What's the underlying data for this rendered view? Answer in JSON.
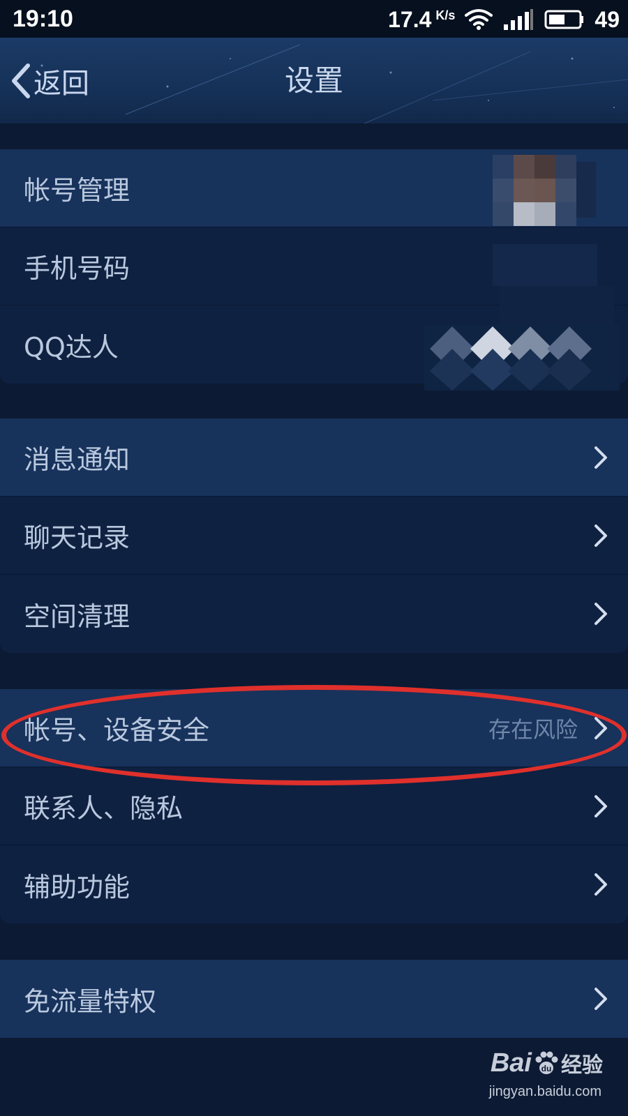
{
  "status_bar": {
    "time": "19:10",
    "net_speed": "17.4",
    "net_speed_unit": "K/s",
    "battery_level": "49",
    "icons": [
      "wifi-icon",
      "signal-icon",
      "battery-icon"
    ]
  },
  "header": {
    "back_label": "返回",
    "title": "设置"
  },
  "groups": [
    {
      "items": [
        {
          "label": "帐号管理",
          "highlight": true
        },
        {
          "label": "手机号码",
          "highlight": false
        },
        {
          "label": "QQ达人",
          "highlight": false
        }
      ]
    },
    {
      "items": [
        {
          "label": "消息通知",
          "highlight": true
        },
        {
          "label": "聊天记录",
          "highlight": false
        },
        {
          "label": "空间清理",
          "highlight": false
        }
      ]
    },
    {
      "items": [
        {
          "label": "帐号、设备安全",
          "value": "存在风险",
          "highlight": true
        },
        {
          "label": "联系人、隐私",
          "highlight": false
        },
        {
          "label": "辅助功能",
          "highlight": false
        }
      ]
    },
    {
      "items": [
        {
          "label": "免流量特权",
          "highlight": true
        }
      ]
    }
  ],
  "watermark": {
    "brand_latin": "Bai",
    "brand_cn": "经验",
    "url": "jingyan.baidu.com"
  },
  "colors": {
    "background": "#0c1a33",
    "row": "#0e2141",
    "row_highlight": "#17325b",
    "annotation": "#e0302c"
  }
}
